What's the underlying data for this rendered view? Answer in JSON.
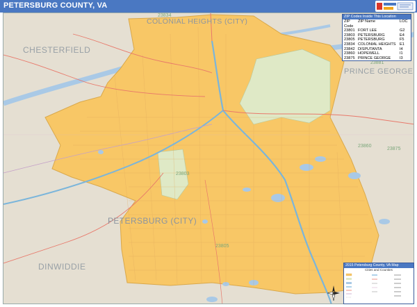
{
  "header": {
    "title": "PETERSBURG COUNTY, VA",
    "accent_color": "#4a78c2"
  },
  "logo": {
    "icon": "marketmaps-logo-icon"
  },
  "map": {
    "county_labels": [
      "CHESTERFIELD",
      "PRINCE GEORGE",
      "DINWIDDIE"
    ],
    "city_labels": [
      "COLONIAL HEIGHTS (CITY)",
      "PETERSBURG (CITY)"
    ],
    "zip_labels": [
      "23834",
      "23803",
      "23805",
      "23860",
      "23875",
      "23881"
    ],
    "colors": {
      "background": "#e5dfd2",
      "city_fill": "#f8c766",
      "water": "#a9c9e6",
      "park": "#dfe9c6",
      "highway": "#7ab5db",
      "main_road": "#e8786a"
    }
  },
  "zip_table": {
    "title": "ZIP Codes Inside This Location",
    "headers": [
      "ZIP Code",
      "ZIP Name",
      "LOC"
    ],
    "rows": [
      [
        "23801",
        "FORT LEE",
        "G2"
      ],
      [
        "23803",
        "PETERSBURG",
        "E4"
      ],
      [
        "23805",
        "PETERSBURG",
        "F5"
      ],
      [
        "23834",
        "COLONIAL HEIGHTS",
        "E1"
      ],
      [
        "23842",
        "DISPUTANTA",
        "I4"
      ],
      [
        "23860",
        "HOPEWELL",
        "I1"
      ],
      [
        "23875",
        "PRINCE GEORGE",
        "I3"
      ]
    ]
  },
  "legend": {
    "title": "2015 Petersburg County, VA Map",
    "subtitle": "Cities and Counties"
  },
  "compass": {
    "icon": "compass-rose-icon"
  }
}
